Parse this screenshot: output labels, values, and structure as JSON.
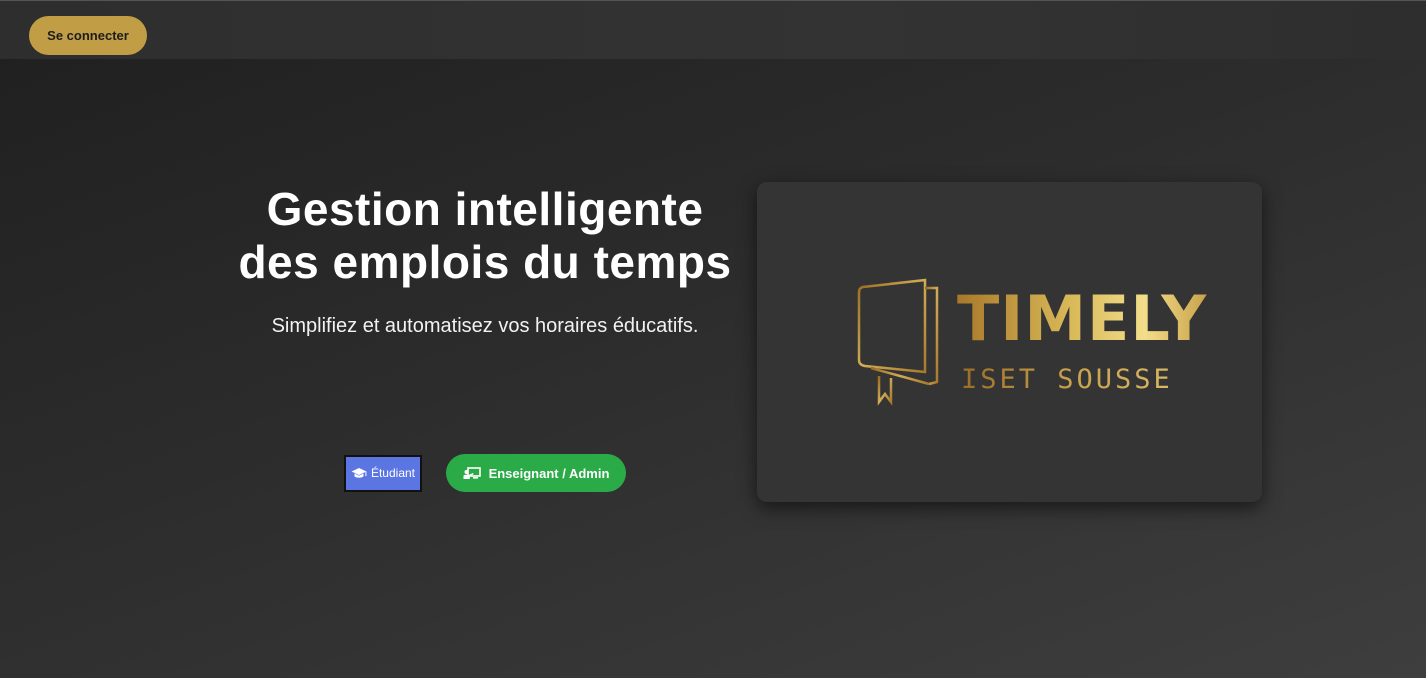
{
  "header": {
    "login_label": "Se connecter"
  },
  "hero": {
    "title": "Gestion intelligente des emplois du temps",
    "subtitle": "Simplifiez et automatisez vos horaires éducatifs."
  },
  "actions": {
    "student_label": "Étudiant",
    "student_icon": "graduation-cap-icon",
    "teacher_label": "Enseignant / Admin",
    "teacher_icon": "chalkboard-teacher-icon"
  },
  "logo": {
    "brand": "TIMELY",
    "subtitle": "ISET SOUSSE",
    "icon": "book-icon"
  },
  "colors": {
    "gold": "#c19d45",
    "student_blue": "#5b75e3",
    "teacher_green": "#2aab48"
  }
}
